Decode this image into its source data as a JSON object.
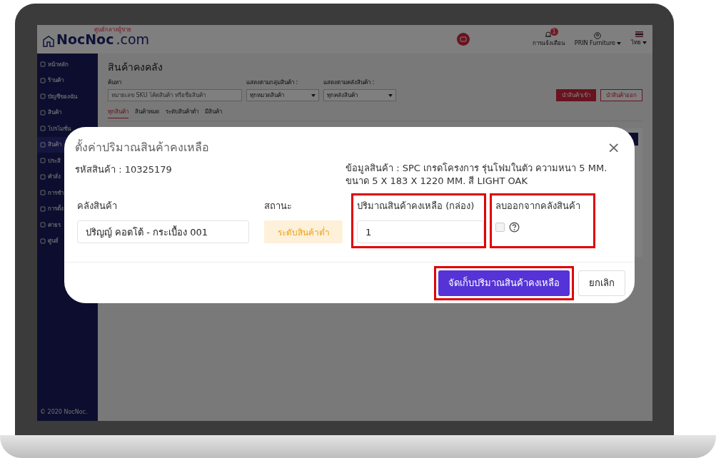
{
  "header": {
    "logo": {
      "name": "NocNoc",
      "domain": ".com",
      "tagline": "ศูนย์กลางผู้ขาย"
    },
    "notifications": {
      "label": "การแจ้งเตือน",
      "badge": "1"
    },
    "account": "PRIN Furniture",
    "language": "ไทย"
  },
  "sidebar": {
    "items": [
      {
        "label": "หน้าหลัก",
        "selected": false
      },
      {
        "label": "ร้านค้า",
        "selected": false
      },
      {
        "label": "บัญชีของฉัน",
        "selected": false
      },
      {
        "label": "สินค้า",
        "selected": false
      },
      {
        "label": "โปรโมชั่น",
        "selected": false
      },
      {
        "label": "สินค้า",
        "selected": true
      },
      {
        "label": "ประสิ",
        "selected": false
      },
      {
        "label": "คำสั่ง",
        "selected": false
      },
      {
        "label": "การชำ",
        "selected": false
      },
      {
        "label": "การตั้ง",
        "selected": false
      },
      {
        "label": "ค่าธร",
        "selected": false
      },
      {
        "label": "ศูนย์",
        "selected": false
      }
    ],
    "footer": "© 2020 NocNoc."
  },
  "page": {
    "title": "สินค้าคงคลัง",
    "search": {
      "label": "ค้นหา",
      "placeholder": "หมายเลข SKU โค้ดสินค้า หรือชื่อสินค้า"
    },
    "filters": [
      {
        "label": "แสดงตามกลุ่มสินค้า :",
        "value": "ทุกหมวดสินค้า"
      },
      {
        "label": "แสดงตามคลังสินค้า :",
        "value": "ทุกคลังสินค้า"
      }
    ],
    "buttons": [
      {
        "label": "นำสินค้าเข้า",
        "kind": "primary"
      },
      {
        "label": "นำสินค้าออก",
        "kind": "outline"
      }
    ],
    "tabs": [
      {
        "label": "ทุกสินค้า",
        "selected": true
      },
      {
        "label": "สินค้าหมด",
        "selected": false
      },
      {
        "label": "ระดับสินค้าต่ำ",
        "selected": false
      },
      {
        "label": "มีสินค้า",
        "selected": false
      }
    ]
  },
  "modal": {
    "title": "ตั้งค่าปริมาณสินค้าคงเหลือ",
    "close": "×",
    "sku": "รหัสสินค้า : 10325179",
    "info": "ข้อมูลสินค้า : SPC เกรดโครงการ รุ่นโฟมในตัว ความหนา 5 MM. ขนาด 5 X 183 X 1220 MM. สี LIGHT OAK",
    "warehouse": {
      "label": "คลังสินค้า",
      "value": "ปริญญ์ คอตโต้ - กระเบื้อง 001",
      "highlighted": false
    },
    "status": {
      "label": "สถานะ",
      "value": "ระดับสินค้าต่ำ",
      "highlighted": false
    },
    "quantity": {
      "label": "ปริมาณสินค้าคงเหลือ (กล่อง)",
      "value": "1",
      "highlighted": true
    },
    "remove": {
      "label": "ลบออกจากคลังสินค้า",
      "checked": false,
      "highlighted": true
    },
    "save": {
      "label": "จัดเก็บปริมาณสินค้าคงเหลือ",
      "highlighted": true
    },
    "cancel": {
      "label": "ยกเลิก",
      "highlighted": false
    }
  }
}
